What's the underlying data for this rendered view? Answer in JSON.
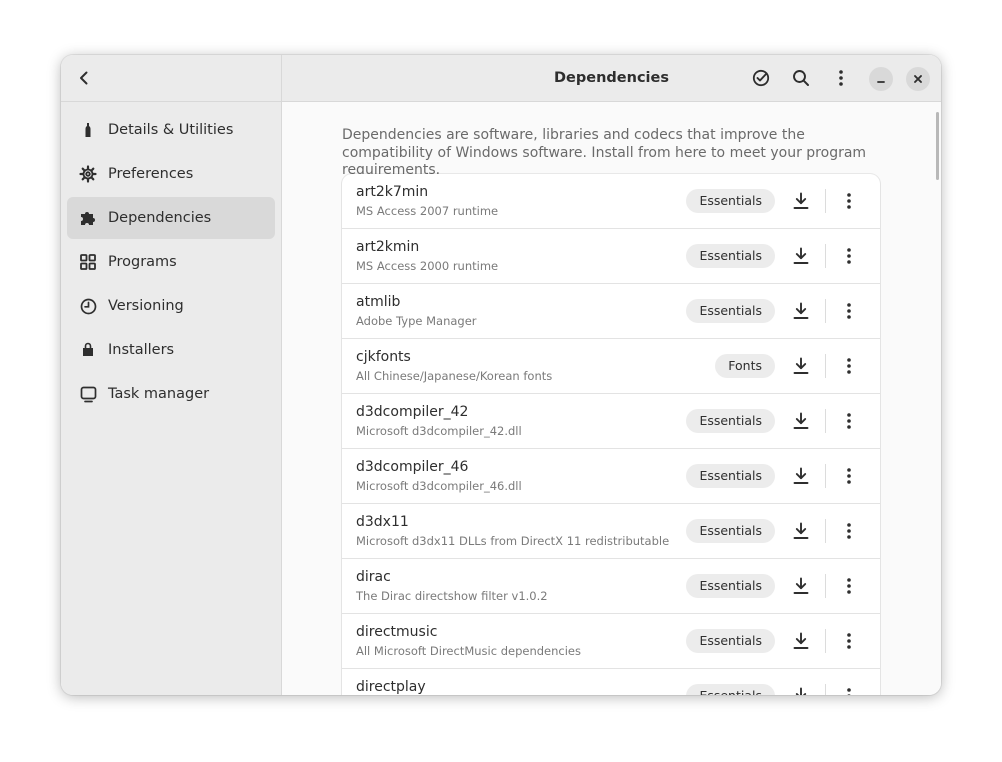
{
  "window": {
    "title": "Dependencies"
  },
  "sidebar": {
    "items": [
      {
        "label": "Details & Utilities",
        "icon": "bottle-icon"
      },
      {
        "label": "Preferences",
        "icon": "gear-icon"
      },
      {
        "label": "Dependencies",
        "icon": "puzzle-icon",
        "active": true
      },
      {
        "label": "Programs",
        "icon": "grid-icon"
      },
      {
        "label": "Versioning",
        "icon": "history-icon"
      },
      {
        "label": "Installers",
        "icon": "bag-icon"
      },
      {
        "label": "Task manager",
        "icon": "monitor-icon"
      }
    ]
  },
  "main": {
    "description": "Dependencies are software, libraries and codecs that improve the compatibility of Windows software. Install from here to meet your program requirements.",
    "dependencies": [
      {
        "name": "art2k7min",
        "description": "MS Access 2007 runtime",
        "category": "Essentials"
      },
      {
        "name": "art2kmin",
        "description": "MS Access 2000 runtime",
        "category": "Essentials"
      },
      {
        "name": "atmlib",
        "description": "Adobe Type Manager",
        "category": "Essentials"
      },
      {
        "name": "cjkfonts",
        "description": "All Chinese/Japanese/Korean fonts",
        "category": "Fonts"
      },
      {
        "name": "d3dcompiler_42",
        "description": "Microsoft d3dcompiler_42.dll",
        "category": "Essentials"
      },
      {
        "name": "d3dcompiler_46",
        "description": "Microsoft d3dcompiler_46.dll",
        "category": "Essentials"
      },
      {
        "name": "d3dx11",
        "description": "Microsoft d3dx11 DLLs from DirectX 11 redistributable",
        "category": "Essentials"
      },
      {
        "name": "dirac",
        "description": "The Dirac directshow filter v1.0.2",
        "category": "Essentials"
      },
      {
        "name": "directmusic",
        "description": "All Microsoft DirectMusic dependencies",
        "category": "Essentials"
      },
      {
        "name": "directplay",
        "description": "",
        "category": "Essentials"
      }
    ]
  },
  "icons": {
    "back": "back-arrow-icon",
    "check": "check-circle-icon",
    "search": "search-icon",
    "menu": "kebab-menu-icon",
    "minimize": "minimize-icon",
    "close": "close-icon",
    "download": "download-icon"
  }
}
